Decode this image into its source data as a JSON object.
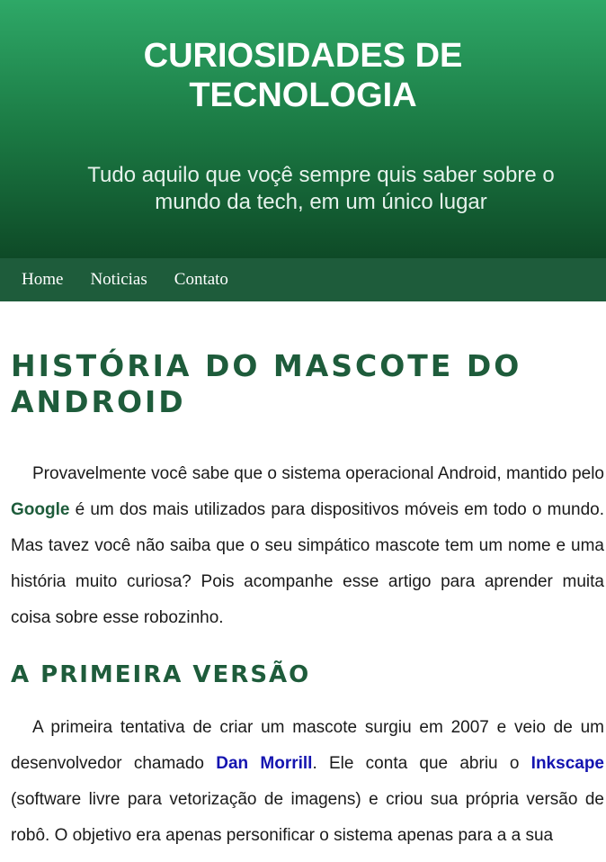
{
  "header": {
    "title": "CURIOSIDADES DE TECNOLOGIA",
    "subtitle": "Tudo aquilo que voçê sempre quis saber sobre o mundo da tech, em um único lugar"
  },
  "nav": {
    "items": [
      {
        "label": "Home"
      },
      {
        "label": "Noticias"
      },
      {
        "label": "Contato"
      }
    ]
  },
  "article": {
    "title": "História do Mascote do Android",
    "paragraph1": {
      "before": "Provavelmente você sabe que o sistema operacional Android, mantido pelo ",
      "link": "Google",
      "after": " é um dos mais utilizados para dispositivos móveis em todo o mundo. Mas tavez você não saiba que o seu simpático mascote tem um nome e uma história muito curiosa? Pois acompanhe esse artigo para aprender muita coisa sobre esse robozinho."
    },
    "section1": {
      "title": "A Primeira Versão",
      "paragraph": {
        "part1": "A primeira tentativa de criar um mascote surgiu em 2007 e veio de um desenvolvedor chamado ",
        "link1": "Dan Morrill",
        "part2": ". Ele conta que abriu o ",
        "link2": "Inkscape",
        "part3": " (software livre para vetorização de imagens) e criou sua própria versão de robô. O objetivo era apenas personificar o sistema apenas para a a sua"
      }
    }
  },
  "colors": {
    "header_top": "#2ea867",
    "header_bottom": "#0e4a27",
    "nav_bg": "#1e5c3b",
    "heading": "#1e5c3b",
    "link_blue": "#1414b0"
  }
}
